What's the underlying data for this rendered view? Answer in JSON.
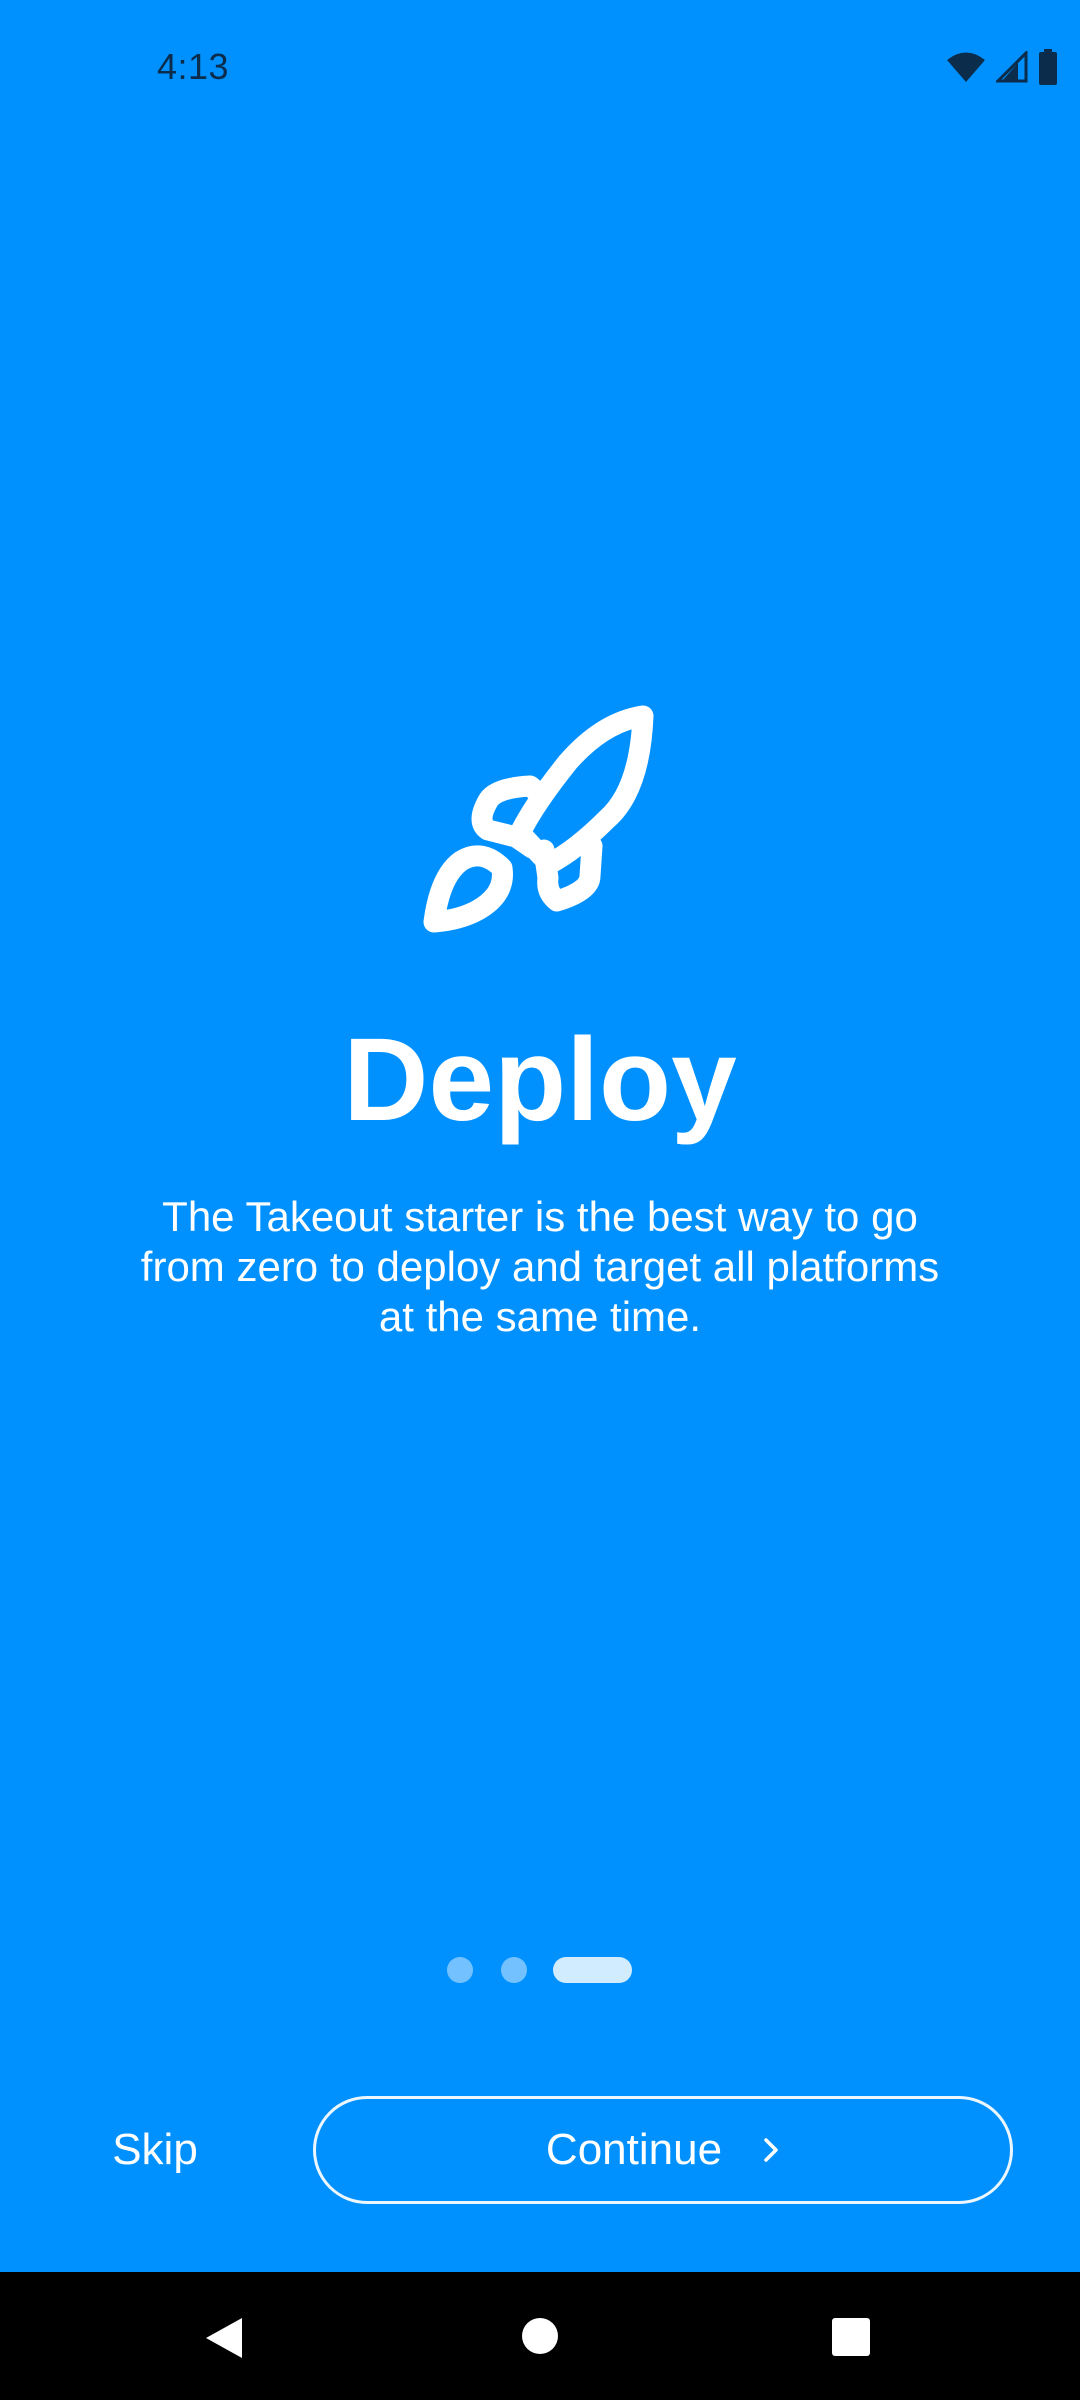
{
  "status_bar": {
    "time": "4:13",
    "icons": [
      "wifi-icon",
      "cellular-signal-icon",
      "battery-icon"
    ]
  },
  "onboarding": {
    "icon": "rocket-icon",
    "title": "Deploy",
    "description": "The Takeout starter is the best way to go from zero to deploy and target all platforms at the same time.",
    "pager": {
      "total_pages": 3,
      "current_page": 3
    }
  },
  "actions": {
    "skip_label": "Skip",
    "continue_label": "Continue"
  },
  "navigation_bar": {
    "buttons": [
      "back-icon",
      "home-icon",
      "recents-icon"
    ]
  },
  "colors": {
    "background": "#0091FF",
    "foreground": "#FFFFFF",
    "status_text": "#0B2C4A",
    "nav_bar": "#000000"
  }
}
